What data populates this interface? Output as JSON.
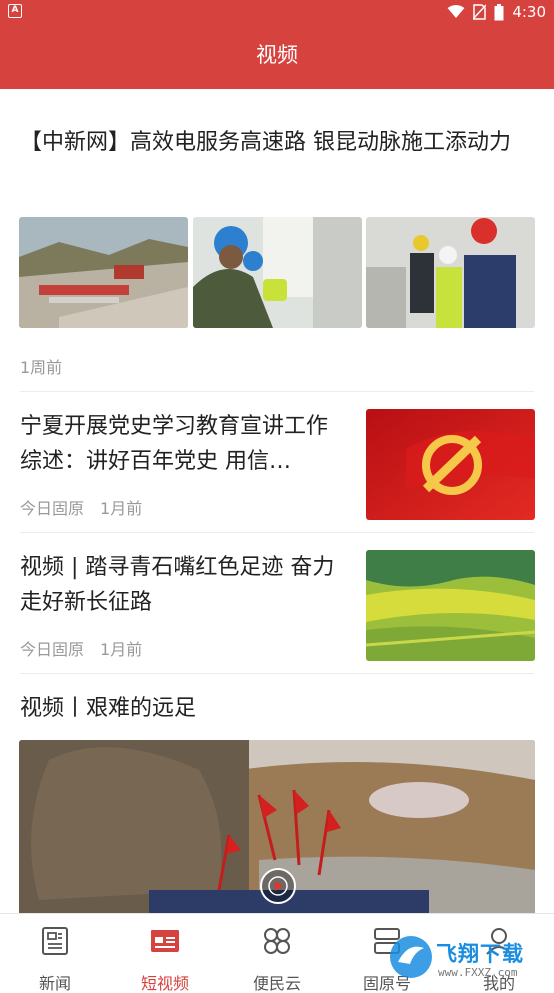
{
  "status_bar": {
    "app_indicator": "A",
    "time": "4:30",
    "icons": [
      "wifi-icon",
      "no-sim-icon",
      "battery-icon"
    ]
  },
  "header": {
    "title": "视频"
  },
  "articles": [
    {
      "title": "【中新网】高效电服务高速路 银昆动脉施工添动力",
      "meta": "1周前"
    },
    {
      "title": "宁夏开展党史学习教育宣讲工作综述：讲好百年党史 用信…",
      "source": "今日固原",
      "time": "1月前"
    },
    {
      "title": "视频 | 踏寻青石嘴红色足迹 奋力走好新长征路",
      "source": "今日固原",
      "time": "1月前"
    },
    {
      "title": "视频丨艰难的远足"
    }
  ],
  "tabs": [
    {
      "label": "新闻",
      "icon": "newspaper-icon",
      "active": false
    },
    {
      "label": "短视频",
      "icon": "video-news-icon",
      "active": true
    },
    {
      "label": "便民云",
      "icon": "four-petal-icon",
      "active": false
    },
    {
      "label": "固原号",
      "icon": "subscription-icon",
      "active": false
    },
    {
      "label": "我的",
      "icon": "user-icon",
      "active": false
    }
  ],
  "watermark": {
    "text": "飞翔下载",
    "url": "www.FXXZ.com"
  },
  "colors": {
    "brand": "#d6423e",
    "meta": "#999999",
    "tab_inactive": "#555555"
  }
}
